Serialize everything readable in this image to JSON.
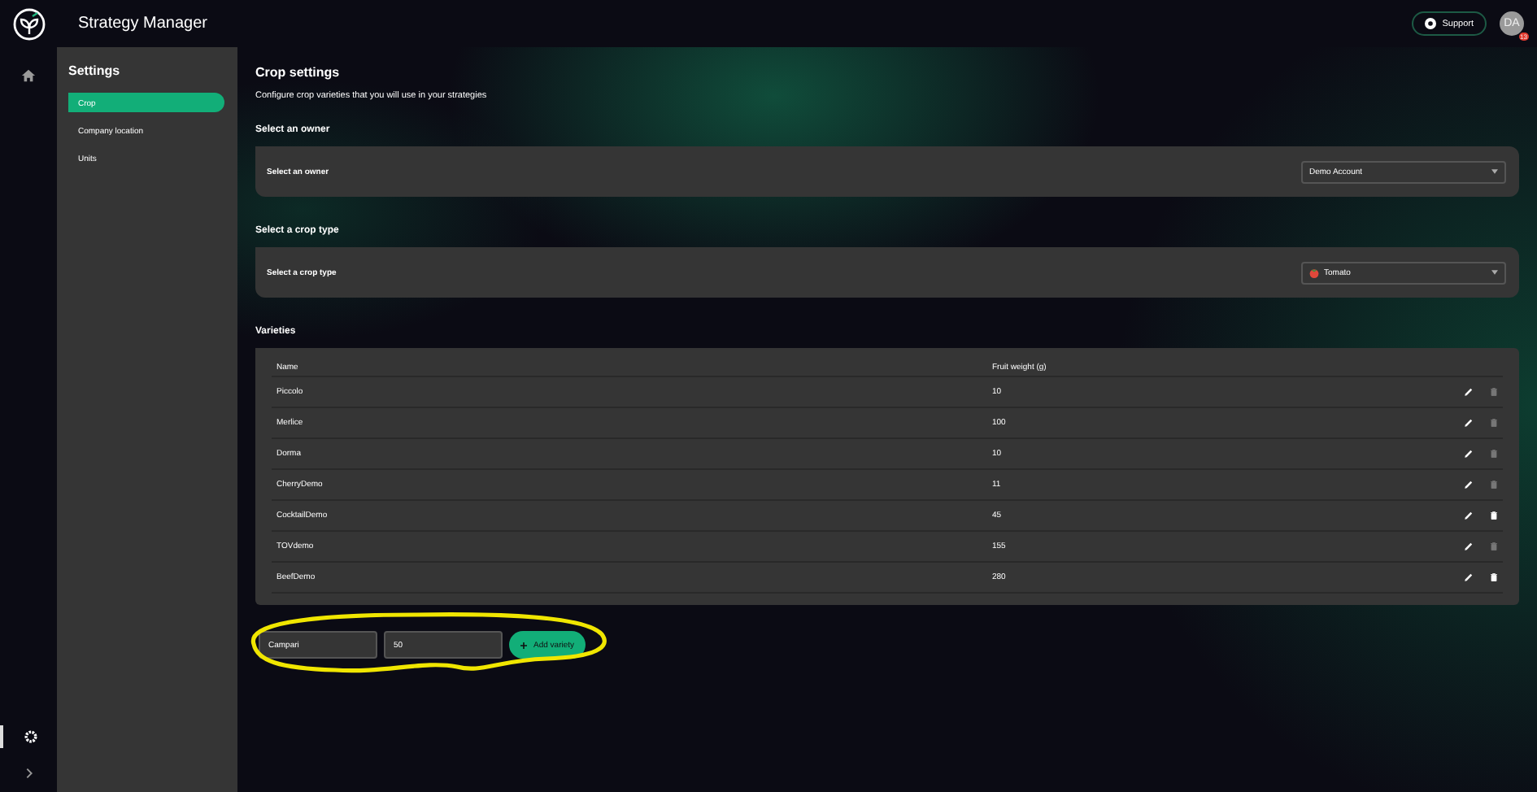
{
  "app": {
    "title": "Strategy Manager",
    "support": "Support",
    "avatar": "DA",
    "notifications": "13"
  },
  "rail": [
    {
      "kind": "home",
      "selected": false
    },
    {
      "kind": "settings",
      "selected": true
    }
  ],
  "sidebar": {
    "title": "Settings",
    "items": [
      {
        "label": "Crop",
        "selected": true
      },
      {
        "label": "Company location",
        "selected": false
      },
      {
        "label": "Units",
        "selected": false
      }
    ]
  },
  "page": {
    "title": "Crop settings",
    "subtitle": "Configure crop varieties that you will use in your strategies"
  },
  "owner": {
    "heading": "Select an owner",
    "label": "Select an owner",
    "value": "Demo Account"
  },
  "crop_type": {
    "heading": "Select a crop type",
    "label": "Select a crop type",
    "value": "Tomato"
  },
  "varieties": {
    "heading": "Varieties",
    "columns": [
      "Name",
      "Fruit weight (g)"
    ],
    "rows": [
      {
        "name": "Piccolo",
        "weight": "10",
        "deletable": false
      },
      {
        "name": "Merlice",
        "weight": "100",
        "deletable": false
      },
      {
        "name": "Dorma",
        "weight": "10",
        "deletable": false
      },
      {
        "name": "CherryDemo",
        "weight": "11",
        "deletable": false
      },
      {
        "name": "CocktailDemo",
        "weight": "45",
        "deletable": true
      },
      {
        "name": "TOVdemo",
        "weight": "155",
        "deletable": false
      },
      {
        "name": "BeefDemo",
        "weight": "280",
        "deletable": true
      }
    ]
  },
  "new_variety": {
    "name": "Campari",
    "weight": "50",
    "button": "Add variety"
  }
}
